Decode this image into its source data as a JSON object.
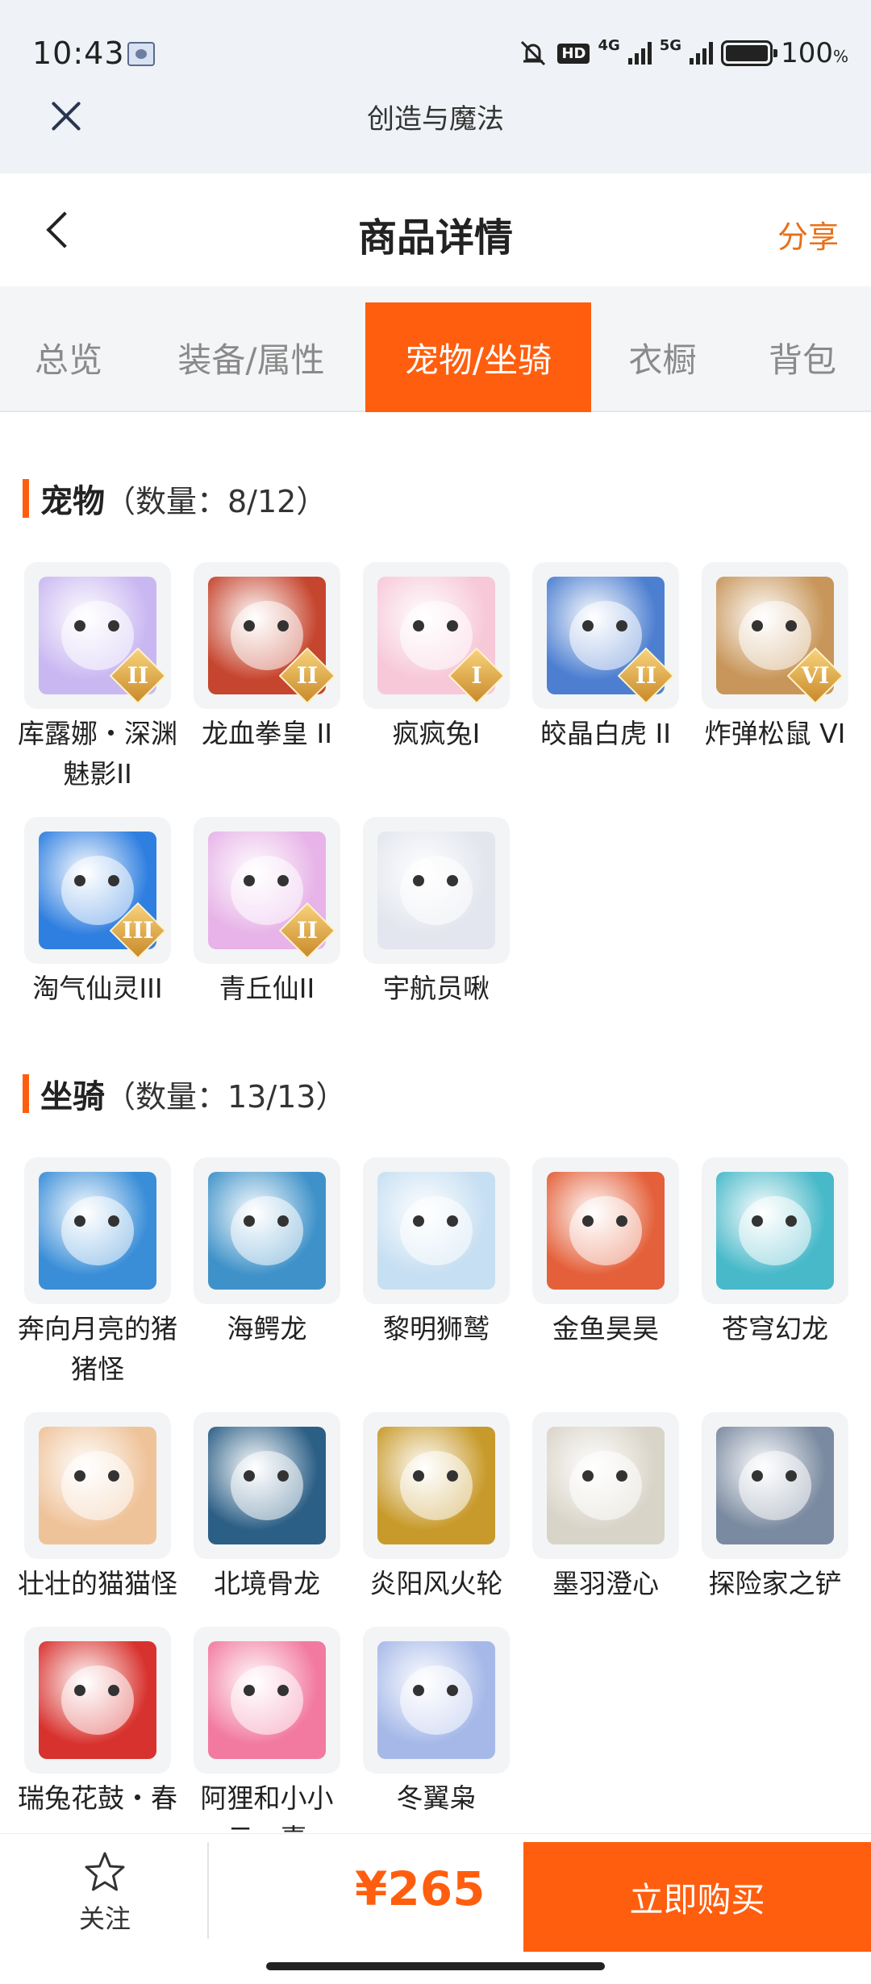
{
  "status_bar": {
    "time": "10:43",
    "network_hd": "HD",
    "network_4g": "4G",
    "network_5g": "5G",
    "battery": "100",
    "battery_unit": "%"
  },
  "mini_app": {
    "title": "创造与魔法"
  },
  "header": {
    "title": "商品详情",
    "share": "分享"
  },
  "tabs": [
    {
      "label": "总览",
      "active": false
    },
    {
      "label": "装备/属性",
      "active": false
    },
    {
      "label": "宠物/坐骑",
      "active": true
    },
    {
      "label": "衣橱",
      "active": false
    },
    {
      "label": "背包",
      "active": false
    }
  ],
  "pets": {
    "title": "宠物",
    "count": "（数量：8/12）",
    "items": [
      {
        "name": "库露娜・深渊魅影II",
        "badge": "II",
        "color": "#c9b7f2"
      },
      {
        "name": "龙血拳皇 II",
        "badge": "II",
        "color": "#c6452e"
      },
      {
        "name": "疯疯兔I",
        "badge": "I",
        "color": "#f7c8d8"
      },
      {
        "name": "皎晶白虎 II",
        "badge": "II",
        "color": "#4d7fd1"
      },
      {
        "name": "炸弹松鼠 VI",
        "badge": "VI",
        "color": "#c8965a"
      },
      {
        "name": "淘气仙灵III",
        "badge": "III",
        "color": "#2f7fe0"
      },
      {
        "name": "青丘仙II",
        "badge": "II",
        "color": "#e7b3e8"
      },
      {
        "name": "宇航员啾",
        "badge": "",
        "color": "#e3e6ee"
      }
    ]
  },
  "mounts": {
    "title": "坐骑",
    "count": "（数量：13/13）",
    "items": [
      {
        "name": "奔向月亮的猪猪怪",
        "color": "#3a8ed8"
      },
      {
        "name": "海鳄龙",
        "color": "#3f92c9"
      },
      {
        "name": "黎明狮鹫",
        "color": "#c6dff2"
      },
      {
        "name": "金鱼昊昊",
        "color": "#e4603a"
      },
      {
        "name": "苍穹幻龙",
        "color": "#48b9c9"
      },
      {
        "name": "壮壮的猫猫怪",
        "color": "#efc39a"
      },
      {
        "name": "北境骨龙",
        "color": "#2c5f86"
      },
      {
        "name": "炎阳风火轮",
        "color": "#c89a2b"
      },
      {
        "name": "墨羽澄心",
        "color": "#d9d4c8"
      },
      {
        "name": "探险家之铲",
        "color": "#7a8aa0"
      },
      {
        "name": "瑞兔花鼓・春",
        "color": "#d8322e"
      },
      {
        "name": "阿狸和小小云・喜",
        "color": "#f27aa0"
      },
      {
        "name": "冬翼枭",
        "color": "#a5b8e8"
      }
    ]
  },
  "bottom_bar": {
    "follow": "关注",
    "price": "¥265",
    "buy": "立即购买"
  },
  "icons": {
    "close": "close-icon",
    "back": "chevron-left-icon",
    "follow": "star-outline-icon"
  },
  "colors": {
    "accent": "#ff5e0e",
    "share": "#e8701a"
  }
}
